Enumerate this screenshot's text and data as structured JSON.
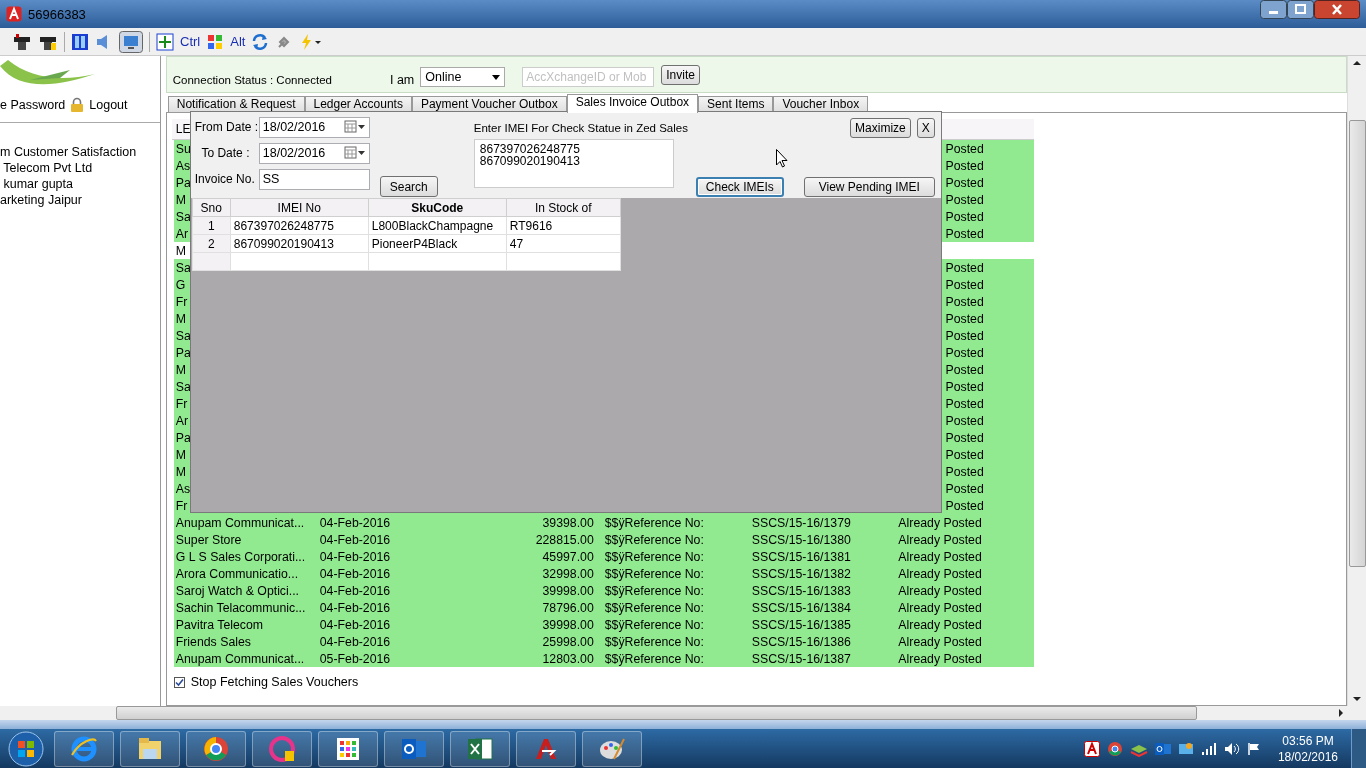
{
  "window": {
    "title": "56966383"
  },
  "toolbar": {
    "ctrl_label": "Ctrl",
    "alt_label": "Alt"
  },
  "sidebar": {
    "password_link": "e Password",
    "logout_link": "Logout",
    "items": [
      "m Customer Satisfaction",
      " Telecom Pvt Ltd",
      " kumar gupta",
      "arketing Jaipur"
    ]
  },
  "connection": {
    "status": "Connection Status : Connected",
    "presence_label": "I am",
    "presence_value": "Online",
    "invite_placeholder": "AccXchangeID or Mob",
    "invite_button": "Invite"
  },
  "tabs": [
    {
      "label": "Notification & Request",
      "selected": false
    },
    {
      "label": "Ledger Accounts",
      "selected": false
    },
    {
      "label": "Payment Voucher Outbox",
      "selected": false
    },
    {
      "label": "Sales Invoice Outbox",
      "selected": true
    },
    {
      "label": "Sent Items",
      "selected": false
    },
    {
      "label": "Voucher Inbox",
      "selected": false
    }
  ],
  "vouchers": {
    "header": "LE",
    "rows": [
      {
        "name": "Su",
        "status": "Posted",
        "highlighted": true
      },
      {
        "name": "As",
        "status": "Posted",
        "highlighted": true
      },
      {
        "name": "Pa",
        "status": "Posted",
        "highlighted": true
      },
      {
        "name": "M",
        "status": "Posted",
        "highlighted": true
      },
      {
        "name": "Sa",
        "status": "Posted",
        "highlighted": true
      },
      {
        "name": "Ar",
        "status": "Posted",
        "highlighted": true
      },
      {
        "name": "M",
        "highlighted": false
      },
      {
        "name": "Sa",
        "status": "Posted",
        "highlighted": true
      },
      {
        "name": "G",
        "status": "Posted",
        "highlighted": true
      },
      {
        "name": "Fr",
        "status": "Posted",
        "highlighted": true
      },
      {
        "name": "M",
        "status": "Posted",
        "highlighted": true
      },
      {
        "name": "Sa",
        "status": "Posted",
        "highlighted": true
      },
      {
        "name": "Pa",
        "status": "Posted",
        "highlighted": true
      },
      {
        "name": "M",
        "status": "Posted",
        "highlighted": true
      },
      {
        "name": "Sa",
        "status": "Posted",
        "highlighted": true
      },
      {
        "name": "Fr",
        "status": "Posted",
        "highlighted": true
      },
      {
        "name": "Ar",
        "status": "Posted",
        "highlighted": true
      },
      {
        "name": "Pa",
        "status": "Posted",
        "highlighted": true
      },
      {
        "name": "M",
        "status": "Posted",
        "highlighted": true
      },
      {
        "name": "M",
        "status": "Posted",
        "highlighted": true
      },
      {
        "name": "As",
        "status": "Posted",
        "highlighted": true
      },
      {
        "name": "Fr",
        "status": "Posted",
        "highlighted": true
      },
      {
        "name": "Anupam Communicat...",
        "date": "04-Feb-2016",
        "amount": "39398.00",
        "ref_label": "$$ÿReference No:",
        "ref_no": "SSCS/15-16/1379",
        "status": "Already Posted",
        "highlighted": true
      },
      {
        "name": "Super Store",
        "date": "04-Feb-2016",
        "amount": "228815.00",
        "ref_label": "$$ÿReference No:",
        "ref_no": "SSCS/15-16/1380",
        "status": "Already Posted",
        "highlighted": true
      },
      {
        "name": "G L S Sales Corporati...",
        "date": "04-Feb-2016",
        "amount": "45997.00",
        "ref_label": "$$ÿReference No:",
        "ref_no": "SSCS/15-16/1381",
        "status": "Already Posted",
        "highlighted": true
      },
      {
        "name": "Arora Communicatio...",
        "date": "04-Feb-2016",
        "amount": "32998.00",
        "ref_label": "$$ÿReference No:",
        "ref_no": "SSCS/15-16/1382",
        "status": "Already Posted",
        "highlighted": true
      },
      {
        "name": "Saroj Watch & Optici...",
        "date": "04-Feb-2016",
        "amount": "39998.00",
        "ref_label": "$$ÿReference No:",
        "ref_no": "SSCS/15-16/1383",
        "status": "Already Posted",
        "highlighted": true
      },
      {
        "name": "Sachin Telacommunic...",
        "date": "04-Feb-2016",
        "amount": "78796.00",
        "ref_label": "$$ÿReference No:",
        "ref_no": "SSCS/15-16/1384",
        "status": "Already Posted",
        "highlighted": true
      },
      {
        "name": "Pavitra Telecom",
        "date": "04-Feb-2016",
        "amount": "39998.00",
        "ref_label": "$$ÿReference No:",
        "ref_no": "SSCS/15-16/1385",
        "status": "Already Posted",
        "highlighted": true
      },
      {
        "name": "Friends Sales",
        "date": "04-Feb-2016",
        "amount": "25998.00",
        "ref_label": "$$ÿReference No:",
        "ref_no": "SSCS/15-16/1386",
        "status": "Already Posted",
        "highlighted": true
      },
      {
        "name": "Anupam Communicat...",
        "date": "05-Feb-2016",
        "amount": "12803.00",
        "ref_label": "$$ÿReference No:",
        "ref_no": "SSCS/15-16/1387",
        "status": "Already Posted",
        "highlighted": true
      }
    ],
    "stop_fetching": {
      "label": "Stop Fetching Sales Vouchers",
      "checked": true
    }
  },
  "dialog": {
    "from_label": "From Date :",
    "from_value": "18/02/2016",
    "to_label": "To Date :",
    "to_value": "18/02/2016",
    "invoice_label": "Invoice No.",
    "invoice_value": "SS",
    "search_button": "Search",
    "imei_label": "Enter IMEI For Check Statue in Zed Sales",
    "imei_lines": [
      "867397026248775",
      "867099020190413"
    ],
    "maximize_button": "Maximize",
    "close_button": "X",
    "check_button": {
      "label": "Check IMEIs",
      "focused": true
    },
    "pending_button": {
      "label": "View Pending IMEI",
      "focused": false
    },
    "grid": {
      "columns": [
        {
          "label": "Sno",
          "sorted": false
        },
        {
          "label": "IMEI No",
          "sorted": false
        },
        {
          "label": "SkuCode",
          "sorted": true
        },
        {
          "label": "In Stock of",
          "sorted": false
        }
      ],
      "rows": [
        [
          "1",
          "867397026248775",
          "L800BlackChampagne",
          "RT9616"
        ],
        [
          "2",
          "867099020190413",
          "PioneerP4Black",
          "47"
        ]
      ]
    }
  },
  "clock": {
    "time": "03:56 PM",
    "date": "18/02/2016"
  }
}
